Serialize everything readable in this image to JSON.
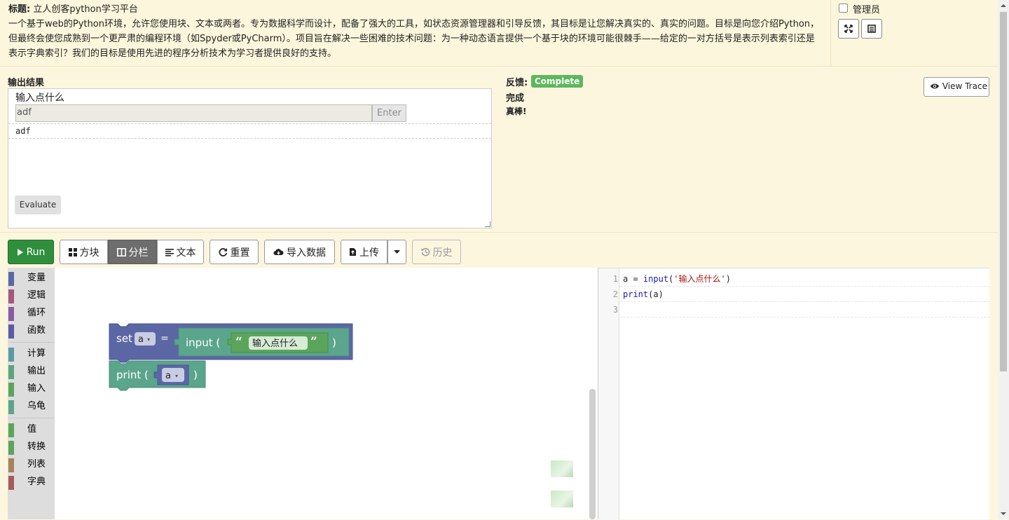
{
  "header": {
    "title_label": "标题:",
    "title": "立人创客python学习平台",
    "description": "一个基于web的Python环境，允许您使用块、文本或两者。专为数据科学而设计，配备了强大的工具，如状态资源管理器和引导反馈，其目标是让您解决真实的、真实的问题。目标是向您介绍Python，但最终会使您成熟到一个更严肃的编程环境（如Spyder或PyCharm）。项目旨在解决一些困难的技术问题：为一种动态语言提供一个基于块的环境可能很棘手——给定的一对方括号是表示列表索引还是表示字典索引？我们的目标是使用先进的程序分析技术为学习者提供良好的支持。",
    "admin_label": "管理员"
  },
  "output": {
    "title": "输出结果",
    "prompt": "输入点什么",
    "input_value": "adf",
    "enter_label": "Enter",
    "printed": "adf",
    "evaluate_label": "Evaluate"
  },
  "feedback": {
    "label": "反馈:",
    "badge": "Complete",
    "title": "完成",
    "message": "真棒!",
    "view_trace_label": "View Trace"
  },
  "toolbar": {
    "run": "Run",
    "blocks": "方块",
    "split": "分栏",
    "text": "文本",
    "reset": "重置",
    "import": "导入数据",
    "upload": "上传",
    "history": "历史"
  },
  "toolbox": {
    "categories": [
      {
        "label": "变量",
        "color": "#5b67a5"
      },
      {
        "label": "逻辑",
        "color": "#a5577e"
      },
      {
        "label": "循环",
        "color": "#8a5ba5"
      },
      {
        "label": "函数",
        "color": "#5b5ba5"
      },
      {
        "label": "计算",
        "color": "#5b9aa5"
      },
      {
        "label": "输出",
        "color": "#5ba57a"
      },
      {
        "label": "输入",
        "color": "#5ba55b"
      },
      {
        "label": "乌龟",
        "color": "#5ba58c"
      },
      {
        "label": "值",
        "color": "#5ba55b"
      },
      {
        "label": "转换",
        "color": "#5ba55b"
      },
      {
        "label": "列表",
        "color": "#a5835b"
      },
      {
        "label": "字典",
        "color": "#a55b5b"
      }
    ]
  },
  "blocks": {
    "set_keyword": "set",
    "set_var": "a",
    "equals": "=",
    "input_call": "input (",
    "input_close": ")",
    "open_quote": "“",
    "close_quote": "”",
    "string_value": "输入点什么",
    "print_call": "print (",
    "print_var": "a",
    "print_close": ")"
  },
  "code": {
    "line_numbers": [
      "1",
      "2",
      "3"
    ],
    "line1": {
      "var": "a = ",
      "func": "input",
      "open": "(",
      "str": "'输入点什么'",
      "close": ")"
    },
    "line2": {
      "func": "print",
      "rest": "(a)"
    }
  }
}
